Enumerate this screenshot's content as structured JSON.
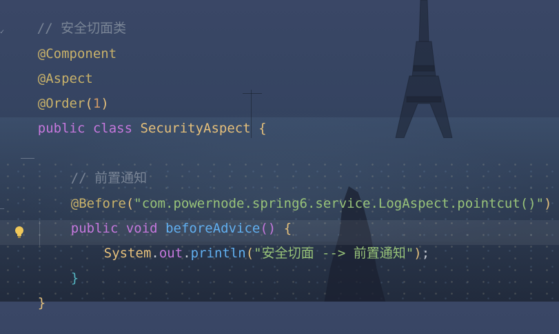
{
  "editor": {
    "lines": [
      {
        "comment": "// 安全切面类"
      },
      {
        "annotation": "@Component"
      },
      {
        "annotation": "@Aspect"
      },
      {
        "annotation": "@Order",
        "paren_open": "(",
        "number": "1",
        "paren_close": ")"
      },
      {
        "kw1": "public",
        "kw2": "class",
        "classname": "SecurityAspect",
        "brace": "{"
      },
      {
        "comment": "// 前置通知"
      },
      {
        "annotation": "@Before",
        "paren_open": "(",
        "string": "\"com.powernode.spring6.service.LogAspect.pointcut()\"",
        "paren_close": ")"
      },
      {
        "kw1": "public",
        "kw2": "void",
        "method": "beforeAdvice",
        "parens": "()",
        "brace": "{"
      },
      {
        "class": "System",
        "dot1": ".",
        "field": "out",
        "dot2": ".",
        "method": "println",
        "paren_open": "(",
        "string": "\"安全切面 --> 前置通知\"",
        "paren_close": ")",
        "semi": ";"
      },
      {
        "brace": "}"
      },
      {
        "brace": "}"
      }
    ]
  },
  "icons": {
    "bulb": "lightbulb-icon"
  },
  "colors": {
    "annotation": "#c9b26a",
    "keyword": "#c678dd",
    "string": "#98c379",
    "function": "#61afef",
    "comment": "#7a8596"
  }
}
